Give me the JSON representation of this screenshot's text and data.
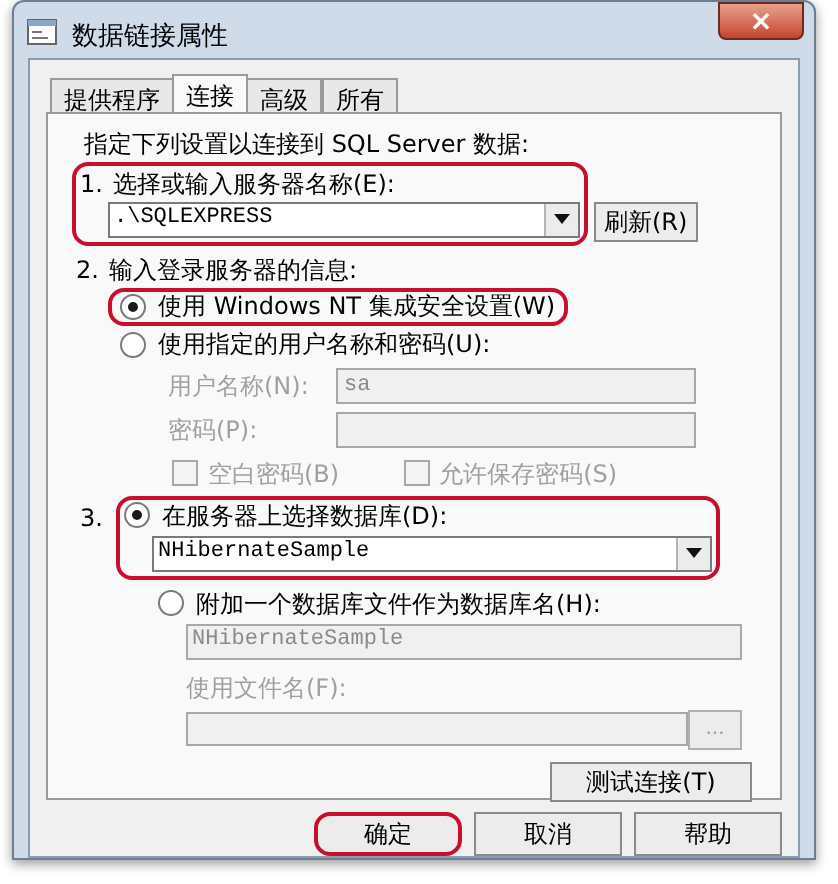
{
  "window": {
    "title": "数据链接属性",
    "close": "×"
  },
  "tabs": [
    {
      "label": "提供程序",
      "selected": false
    },
    {
      "label": "连接",
      "selected": true
    },
    {
      "label": "高级",
      "selected": false
    },
    {
      "label": "所有",
      "selected": false
    }
  ],
  "intro": "指定下列设置以连接到 SQL Server 数据:",
  "step1": {
    "number": "1.",
    "label": "选择或输入服务器名称(E):",
    "value": ".\\SQLEXPRESS",
    "refresh": "刷新(R)",
    "highlighted": true
  },
  "step2": {
    "number": "2.",
    "label": "输入登录服务器的信息:",
    "options": [
      {
        "label": "使用 Windows NT 集成安全设置(W)",
        "selected": true,
        "highlighted": true
      },
      {
        "label": "使用指定的用户名称和密码(U):",
        "selected": false,
        "highlighted": false
      }
    ],
    "disabled": true,
    "username": {
      "label": "用户名称(N):",
      "value": "sa"
    },
    "password": {
      "label": "密码(P):"
    },
    "checkboxes": [
      {
        "label": "空白密码(B)",
        "checked": false
      },
      {
        "label": "允许保存密码(S)",
        "checked": false
      }
    ]
  },
  "step3": {
    "number": "3.",
    "options": [
      {
        "label": "在服务器上选择数据库(D):",
        "selected": true,
        "highlighted": true,
        "value": "NHibernateSample"
      },
      {
        "label": "附加一个数据库文件作为数据库名(H):",
        "selected": false,
        "highlighted": false,
        "value": "NHibernateSample"
      }
    ],
    "file_label": "使用文件名(F):",
    "browse": "...",
    "test": "测试连接(T)"
  },
  "buttons": [
    {
      "label": "确定",
      "highlighted": true
    },
    {
      "label": "取消",
      "highlighted": false
    },
    {
      "label": "帮助",
      "highlighted": false
    }
  ]
}
